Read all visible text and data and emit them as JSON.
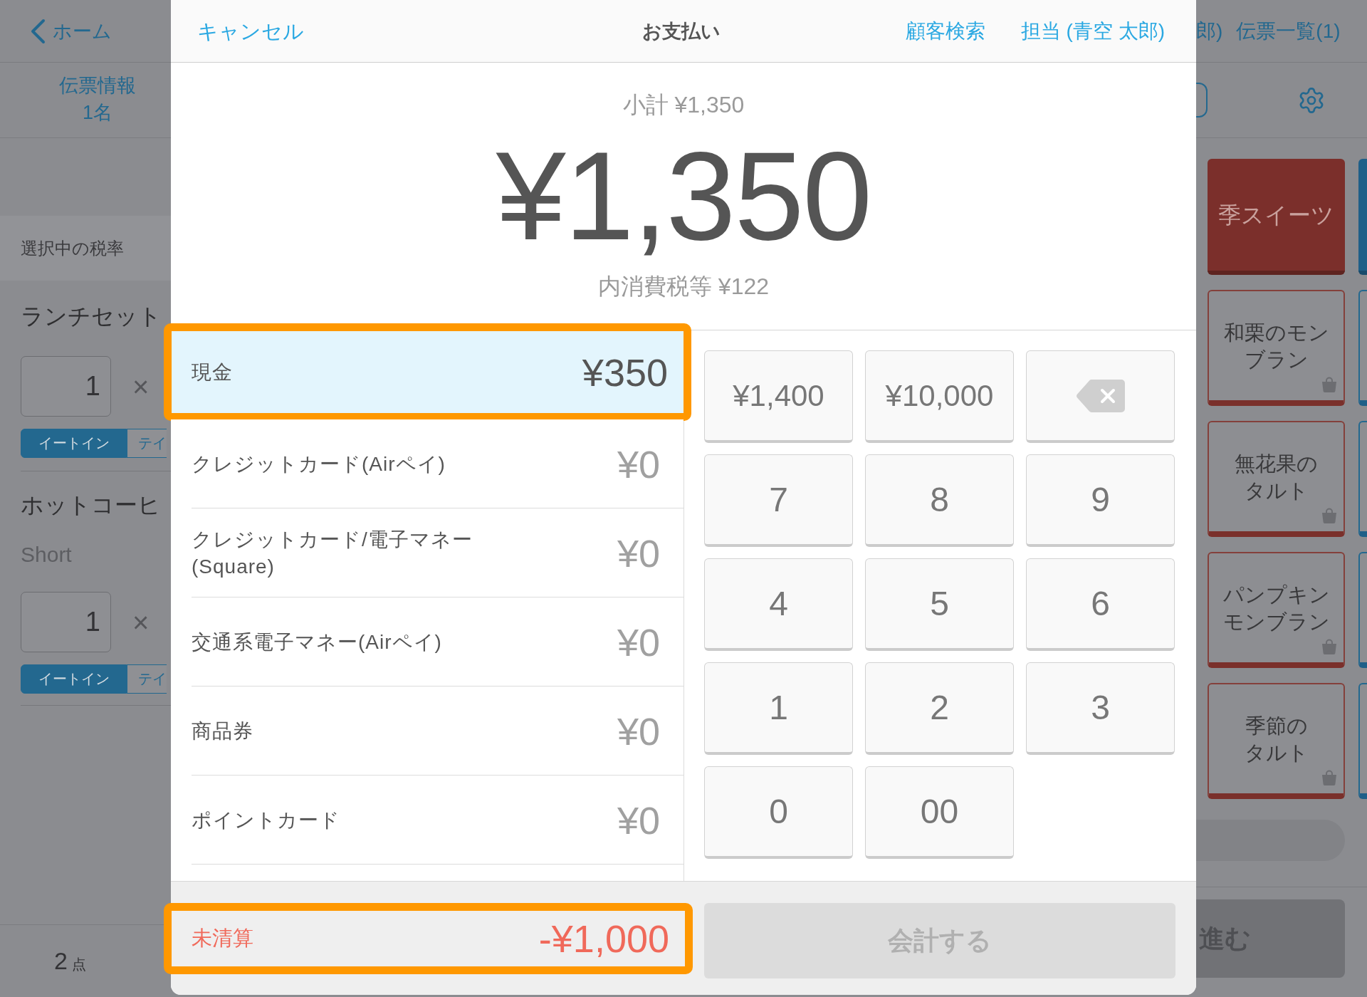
{
  "background_screen": {
    "left_panel": {
      "back_link": "ホーム",
      "slip_info": {
        "title": "伝票情報",
        "guests": "1名"
      },
      "tax_rate_label": "選択中の税率",
      "order_items": [
        {
          "name": "ランチセット",
          "quantity": "1",
          "multiply_sign": "×",
          "dining_options": [
            {
              "label": "イートイン",
              "selected": true
            },
            {
              "label": "テイ",
              "selected": false
            }
          ]
        },
        {
          "name": "ホットコーヒ",
          "variant": "Short",
          "quantity": "1",
          "multiply_sign": "×",
          "dining_options": [
            {
              "label": "イートイン",
              "selected": true
            },
            {
              "label": "テイ",
              "selected": false
            }
          ]
        }
      ],
      "item_count": {
        "value": "2",
        "unit": "点"
      }
    },
    "right_panel": {
      "staff_fragment": "郎)",
      "slip_list_link": "伝票一覧(1)",
      "tiles": [
        {
          "kind": "category",
          "lines": [
            "季スイーツ"
          ]
        },
        {
          "kind": "product",
          "lines": [
            "和栗のモン",
            "ブラン"
          ]
        },
        {
          "kind": "product",
          "lines": [
            "無花果の",
            "タルト"
          ]
        },
        {
          "kind": "product",
          "lines": [
            "パンプキン",
            "モンブラン"
          ]
        },
        {
          "kind": "product",
          "lines": [
            "季節の",
            "タルト"
          ]
        }
      ],
      "edge_tiles": [
        {
          "kind": "category"
        },
        {
          "kind": "product"
        },
        {
          "kind": "product"
        },
        {
          "kind": "product"
        },
        {
          "kind": "product"
        }
      ],
      "next_button": "進む"
    }
  },
  "payment_dialog": {
    "cancel_button": "キャンセル",
    "title": "お支払い",
    "customer_search_link": "顧客検索",
    "staff_link": "担当 (青空 太郎)",
    "subtotal": "小計 ¥1,350",
    "total": "¥1,350",
    "tax_included": "内消費税等 ¥122",
    "payment_methods": [
      {
        "label": "現金",
        "amount": "¥350",
        "selected": true,
        "highlighted": true
      },
      {
        "label": "クレジットカード(Airペイ)",
        "amount": "¥0",
        "selected": false,
        "highlighted": false
      },
      {
        "label": "クレジットカード/電子マネー\n(Square)",
        "amount": "¥0",
        "selected": false,
        "highlighted": false
      },
      {
        "label": "交通系電子マネー(Airペイ)",
        "amount": "¥0",
        "selected": false,
        "highlighted": false
      },
      {
        "label": "商品券",
        "amount": "¥0",
        "selected": false,
        "highlighted": false
      },
      {
        "label": "ポイントカード",
        "amount": "¥0",
        "selected": false,
        "highlighted": false
      }
    ],
    "keypad": [
      {
        "kind": "amount",
        "label": "¥1,400"
      },
      {
        "kind": "amount",
        "label": "¥10,000"
      },
      {
        "kind": "backspace"
      },
      {
        "kind": "digit",
        "label": "7"
      },
      {
        "kind": "digit",
        "label": "8"
      },
      {
        "kind": "digit",
        "label": "9"
      },
      {
        "kind": "digit",
        "label": "4"
      },
      {
        "kind": "digit",
        "label": "5"
      },
      {
        "kind": "digit",
        "label": "6"
      },
      {
        "kind": "digit",
        "label": "1"
      },
      {
        "kind": "digit",
        "label": "2"
      },
      {
        "kind": "digit",
        "label": "3"
      },
      {
        "kind": "digit",
        "label": "0"
      },
      {
        "kind": "digit",
        "label": "00"
      }
    ],
    "balance": {
      "label": "未清算",
      "amount": "-¥1,000",
      "highlighted": true
    },
    "checkout_button": {
      "label": "会計する",
      "disabled": true
    }
  }
}
